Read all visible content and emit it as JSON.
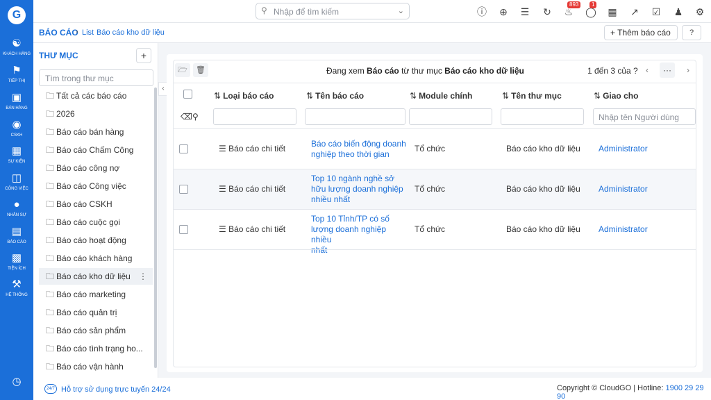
{
  "sidebar": {
    "items": [
      {
        "label": "KHÁCH HÀNG",
        "icon": "users-icon"
      },
      {
        "label": "TIẾP THỊ",
        "icon": "megaphone-icon"
      },
      {
        "label": "BÁN HÀNG",
        "icon": "cart-icon"
      },
      {
        "label": "CSKH",
        "icon": "lifebuoy-icon"
      },
      {
        "label": "SỰ KIỆN",
        "icon": "calendar-icon"
      },
      {
        "label": "CÔNG VIỆC",
        "icon": "briefcase-icon"
      },
      {
        "label": "NHÂN SỰ",
        "icon": "person-icon"
      },
      {
        "label": "BÁO CÁO",
        "icon": "chart-icon"
      },
      {
        "label": "TIỆN ÍCH",
        "icon": "boxes-icon"
      },
      {
        "label": "HỆ THỐNG",
        "icon": "wrench-icon"
      }
    ]
  },
  "topbar": {
    "search_placeholder": "Nhập để tìm kiếm",
    "notifications_count": "893",
    "messages_count": "1"
  },
  "breadcrumb": {
    "root": "BÁO CÁO",
    "list": "List",
    "current": "Báo cáo kho dữ liệu"
  },
  "actions": {
    "add_report": "Thêm báo cáo"
  },
  "folders": {
    "title": "THƯ MỤC",
    "search_placeholder": "Tìm trong thư mục",
    "items": [
      "Tất cả các báo cáo",
      "2026",
      "Báo cáo bán hàng",
      "Báo cáo Chấm Công",
      "Báo cáo công nợ",
      "Báo cáo Công việc",
      "Báo cáo CSKH",
      "Báo cáo cuộc gọi",
      "Báo cáo hoạt động",
      "Báo cáo khách hàng",
      "Báo cáo kho dữ liệu",
      "Báo cáo marketing",
      "Báo cáo quản trị",
      "Báo cáo sản phẩm",
      "Báo cáo tình trạng ho...",
      "Báo cáo vận hành"
    ],
    "active_index": 10
  },
  "table": {
    "viewing_prefix": "Đang xem",
    "viewing_object": "Báo cáo",
    "viewing_mid": "từ thư mục",
    "viewing_folder": "Báo cáo kho dữ liệu",
    "pagination": "1 đến 3 của ?",
    "columns": [
      "Loại báo cáo",
      "Tên báo cáo",
      "Module chính",
      "Tên thư mục",
      "Giao cho"
    ],
    "assignee_filter_placeholder": "Nhập tên Người dùng",
    "rows": [
      {
        "type": "Báo cáo chi tiết",
        "name": [
          "Báo cáo biến động doanh",
          "nghiệp theo thời gian"
        ],
        "module": "Tổ chức",
        "folder": "Báo cáo kho dữ liệu",
        "assignee": "Administrator"
      },
      {
        "type": "Báo cáo chi tiết",
        "name": [
          "Top 10 ngành nghề sở",
          "hữu lượng doanh nghiệp",
          "nhiều nhất"
        ],
        "module": "Tổ chức",
        "folder": "Báo cáo kho dữ liệu",
        "assignee": "Administrator"
      },
      {
        "type": "Báo cáo chi tiết",
        "name": [
          "Top 10 Tỉnh/TP có số",
          "lượng doanh nghiệp nhiều",
          "nhất"
        ],
        "module": "Tổ chức",
        "folder": "Báo cáo kho dữ liệu",
        "assignee": "Administrator"
      }
    ]
  },
  "footer": {
    "logo_text": "24/7",
    "support": "Hỗ trợ sử dụng trực tuyến 24/24",
    "copyright": "Copyright © CloudGO",
    "hotline_label": "Hotline:",
    "hotline": "1900 29 29 90"
  }
}
